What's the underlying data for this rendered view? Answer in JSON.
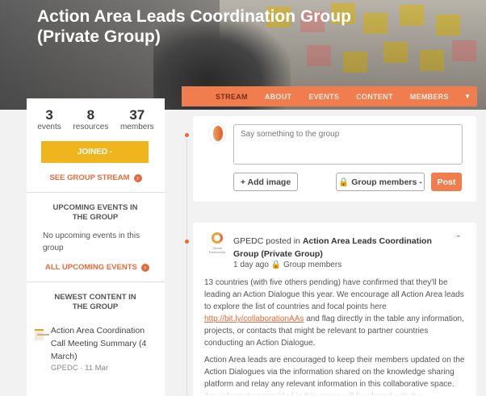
{
  "group": {
    "title": "Action Area Leads Coordination Group (Private Group)"
  },
  "stats": [
    {
      "value": "3",
      "label": "events"
    },
    {
      "value": "8",
      "label": "resources"
    },
    {
      "value": "37",
      "label": "members"
    }
  ],
  "sidebar": {
    "joined_label": "JOINED -",
    "see_stream_label": "SEE GROUP STREAM",
    "upcoming_title": "UPCOMING EVENTS IN THE GROUP",
    "no_events_text": "No upcoming events in this group",
    "all_events_label": "ALL UPCOMING EVENTS",
    "newest_title": "NEWEST CONTENT IN THE GROUP",
    "content_item": {
      "title": "Action Area Coordination Call Meeting Summary (4 March)",
      "meta": "GPEDC · 11 Mar"
    }
  },
  "tabs": [
    "STREAM",
    "ABOUT",
    "EVENTS",
    "CONTENT",
    "MEMBERS"
  ],
  "composer": {
    "placeholder": "Say something to the group",
    "add_image_label": "+ Add image",
    "audience_label": "🔒 Group members -",
    "post_label": "Post"
  },
  "post": {
    "author": "GPEDC",
    "action": "posted in",
    "group": "Action Area Leads Coordination Group (Private Group)",
    "time": "1 day ago",
    "visibility": "Group members",
    "body_1a": "13 countries (with five others pending) have confirmed that they'll be leading an Action Dialogue this year. We encourage all Action Area leads to explore the list of countries and focal points here",
    "link": "http://bit.ly/collaborationAAs",
    "body_1b": "and flag directly in the table any information, projects, or contacts that might be relevant to partner countries conducting an Action Dialogue.",
    "body_2": "Action Area leads are encouraged to keep their members updated on the Action Dialogues via the information shared on the knowledge sharing platform and relay any relevant information in this collaborative space. Any information provided in this space will be shared with the"
  },
  "colors": {
    "accent": "#f07d4d",
    "join": "#f0b41c",
    "link": "#e86a3b"
  }
}
